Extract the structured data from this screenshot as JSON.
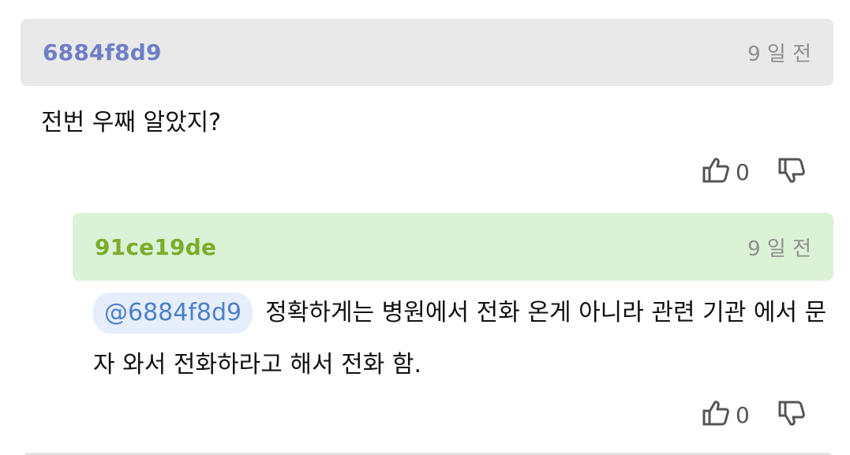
{
  "comment": {
    "author": "6884f8d9",
    "date": "9 일 전",
    "text": "전번 우째 알았지?",
    "likes": "0"
  },
  "reply": {
    "author": "91ce19de",
    "date": "9 일 전",
    "mention": "@6884f8d9",
    "text": "정확하게는 병원에서 전화 온게 아니라 관련 기관 에서 문자 와서 전화하라고 해서 전화 함.",
    "likes": "0"
  },
  "colors": {
    "comment_header_bg": "#e9e9e9",
    "comment_author": "#6f7ec6",
    "reply_header_bg": "#dcf2d7",
    "reply_author": "#7aad2a",
    "mention_text": "#4a80c8"
  },
  "icons": {
    "like": "thumbs-up-outline",
    "dislike": "thumbs-down-outline"
  }
}
